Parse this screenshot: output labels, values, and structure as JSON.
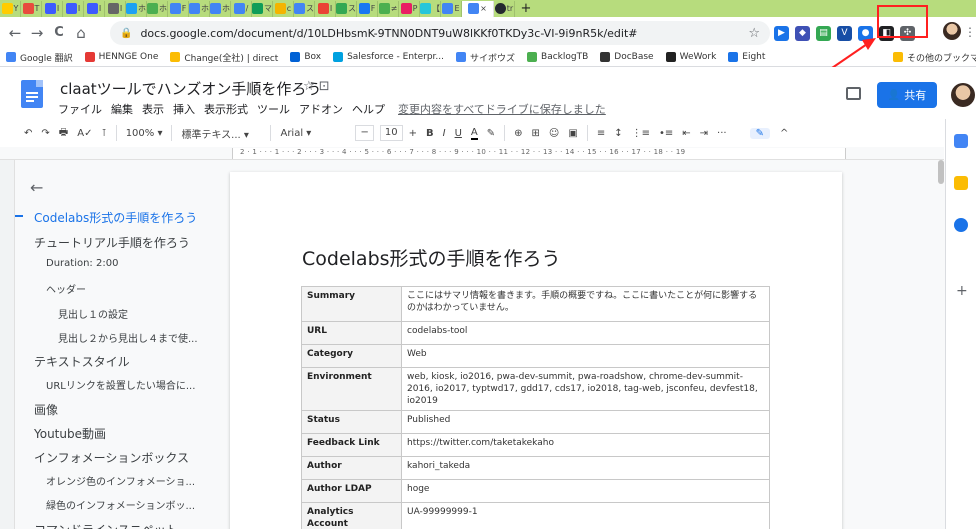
{
  "browser": {
    "tabs": [
      {
        "label": "Y",
        "color": "#ffcc00"
      },
      {
        "label": "T",
        "color": "#e84c3d"
      },
      {
        "label": "I",
        "color": "#3d5afe"
      },
      {
        "label": "I",
        "color": "#3d5afe"
      },
      {
        "label": "I",
        "color": "#3d5afe"
      },
      {
        "label": "I",
        "color": "#666666"
      },
      {
        "label": "ホ",
        "color": "#1da1f2"
      },
      {
        "label": "ホ",
        "color": "#4caf50"
      },
      {
        "label": "F",
        "color": "#4285f4"
      },
      {
        "label": "ホ",
        "color": "#4285f4"
      },
      {
        "label": "ホ",
        "color": "#4285f4"
      },
      {
        "label": "/",
        "color": "#4285f4"
      },
      {
        "label": "マ",
        "color": "#0f9d58"
      },
      {
        "label": "c",
        "color": "#f4b400"
      },
      {
        "label": "ス",
        "color": "#4285f4"
      },
      {
        "label": "I",
        "color": "#ea4335"
      },
      {
        "label": "ス",
        "color": "#34a853"
      },
      {
        "label": "F",
        "color": "#1877f2"
      },
      {
        "label": "≠",
        "color": "#4caf50"
      },
      {
        "label": "P",
        "color": "#e91e63"
      },
      {
        "label": "【",
        "color": "#26c6da"
      },
      {
        "label": "E",
        "color": "#4285f4"
      }
    ],
    "active_tab_label": "×",
    "github_tab_label": "tr",
    "new_tab_label": "+",
    "url": "docs.google.com/document/d/10LDHbsmK-9TNN0DNT9uW8lKKf0TKDy3c-VI-9i9nR5k/edit#",
    "nav": {
      "back": "←",
      "forward": "→",
      "reload": "C",
      "home": "⌂"
    },
    "lock": "🔒",
    "star": "☆",
    "extensions": [
      {
        "color": "#1a73e8",
        "glyph": "▶"
      },
      {
        "color": "#3f51b5",
        "glyph": "◆"
      },
      {
        "color": "#34a853",
        "glyph": "▤"
      },
      {
        "color": "#174ea6",
        "glyph": "V"
      },
      {
        "color": "#1a73e8",
        "glyph": "●"
      },
      {
        "color": "#202124",
        "glyph": "◧"
      },
      {
        "color": "#5f6368",
        "glyph": "✣"
      }
    ]
  },
  "bookmarks": {
    "items": [
      {
        "label": "Google 翻訳",
        "color": "#4285f4"
      },
      {
        "label": "HENNGE One",
        "color": "#e53935"
      },
      {
        "label": "Change(全社) | direct",
        "color": "#fbbc04"
      },
      {
        "label": "Box",
        "color": "#0061d5"
      },
      {
        "label": "Salesforce - Enterpr...",
        "color": "#00a1e0"
      },
      {
        "label": "サイボウズ",
        "color": "#4285f4"
      },
      {
        "label": "BacklogTB",
        "color": "#4caf50"
      },
      {
        "label": "DocBase",
        "color": "#333333"
      },
      {
        "label": "WeWork",
        "color": "#222222"
      },
      {
        "label": "Eight",
        "color": "#1a73e8"
      }
    ],
    "other_label": "その他のブックマーク"
  },
  "doc": {
    "title": "claatツールでハンズオン手順を作ろう",
    "title_icons": "☆ ⊡",
    "menus": [
      "ファイル",
      "編集",
      "表示",
      "挿入",
      "表示形式",
      "ツール",
      "アドオン",
      "ヘルプ"
    ],
    "saved_label": "変更内容をすべてドライブに保存しました",
    "share_label": "共有",
    "share_icon": "👤"
  },
  "toolbar": {
    "undo": "↶",
    "redo": "↷",
    "print": "🖶",
    "spell": "A✓",
    "paint": "⊺",
    "zoom": "100%",
    "style": "標準テキス...",
    "font": "Arial",
    "font_size": "10",
    "minus": "−",
    "plus": "+",
    "bold": "B",
    "italic": "I",
    "underline": "U",
    "text_color": "A",
    "highlight": "✎",
    "link": "⊕",
    "comment": "⊞",
    "emoji": "☺",
    "image": "▣",
    "align": "≡",
    "line_spacing": "↕",
    "numbered": "⋮≡",
    "bulleted": "•≡",
    "indent_less": "⇤",
    "indent_more": "⇥",
    "more": "···",
    "pencil": "✎",
    "collapse": "^"
  },
  "ruler": {
    "numbers": "2 · 1 · · · 1 · · · 2 · · · 3 · · · 4 · · · 5 · · · 6 · · · 7 · · · 8 · · · 9 · · · 10 · · 11 · · 12 · · 13 · · 14 · · 15 · · 16 · · 17 · · 18 · · 19"
  },
  "outline": {
    "back_icon": "←",
    "items": [
      {
        "label": "Codelabs形式の手順を作ろう",
        "level": 1,
        "active": true
      },
      {
        "label": "チュートリアル手順を作ろう",
        "level": 1,
        "active": false
      },
      {
        "label": "Duration: 2:00",
        "level": 2,
        "active": false
      },
      {
        "label": "ヘッダー",
        "level": 2,
        "active": false
      },
      {
        "label": "見出し１の設定",
        "level": 3,
        "active": false
      },
      {
        "label": "見出し２から見出し４まで使...",
        "level": 3,
        "active": false
      },
      {
        "label": "テキストスタイル",
        "level": 1,
        "active": false
      },
      {
        "label": "URLリンクを設置したい場合に...",
        "level": 2,
        "active": false
      },
      {
        "label": "画像",
        "level": 1,
        "active": false
      },
      {
        "label": "Youtube動画",
        "level": 1,
        "active": false
      },
      {
        "label": "インフォメーションボックス",
        "level": 1,
        "active": false
      },
      {
        "label": "オレンジ色のインフォメーショ...",
        "level": 2,
        "active": false
      },
      {
        "label": "緑色のインフォメーションボッ...",
        "level": 2,
        "active": false
      },
      {
        "label": "コマンドラインスニペット",
        "level": 1,
        "active": false
      }
    ]
  },
  "page": {
    "heading": "Codelabs形式の手順を作ろう",
    "table": [
      {
        "key": "Summary",
        "value": "ここにはサマリ情報を書きます。手順の概要ですね。ここに書いたことが何に影響するのかはわかっていません。"
      },
      {
        "key": "URL",
        "value": "codelabs-tool"
      },
      {
        "key": "Category",
        "value": "Web"
      },
      {
        "key": "Environment",
        "value": "web, kiosk, io2016, pwa-dev-summit, pwa-roadshow, chrome-dev-summit-2016, io2017, typtwd17, gdd17, cds17, io2018, tag-web, jsconfeu, devfest18, io2019"
      },
      {
        "key": "Status",
        "value": "Published"
      },
      {
        "key": "Feedback Link",
        "value": "https://twitter.com/taketakekaho"
      },
      {
        "key": "Author",
        "value": "kahori_takeda"
      },
      {
        "key": "Author LDAP",
        "value": "hoge"
      },
      {
        "key": "Analytics Account",
        "value": "UA-99999999-1"
      }
    ]
  },
  "sidepanel": {
    "icons": [
      {
        "name": "calendar-icon",
        "color": "#4285f4"
      },
      {
        "name": "keep-icon",
        "color": "#fbbc04"
      },
      {
        "name": "tasks-icon",
        "color": "#1a73e8"
      }
    ],
    "plus": "+"
  },
  "annotation": {
    "box_color": "#ff2020"
  }
}
